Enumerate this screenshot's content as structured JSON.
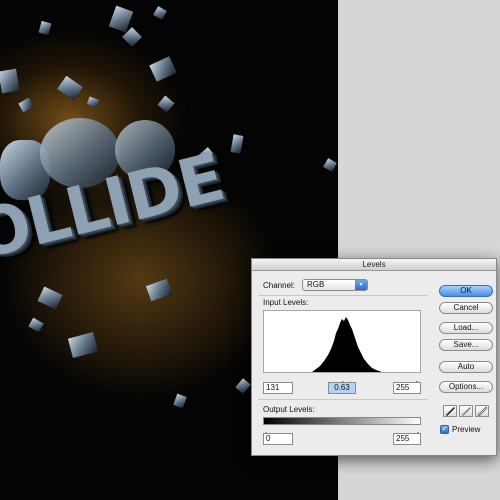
{
  "canvas": {
    "artwork_text": "OLLIDE"
  },
  "dialog": {
    "title": "Levels",
    "channel_label": "Channel:",
    "channel_value": "RGB",
    "input_levels_label": "Input Levels:",
    "input_black": "131",
    "input_gamma": "0.63",
    "input_white": "255",
    "output_levels_label": "Output Levels:",
    "output_black": "0",
    "output_white": "255",
    "buttons": {
      "ok": "OK",
      "cancel": "Cancel",
      "load": "Load...",
      "save": "Save...",
      "auto": "Auto",
      "options": "Options..."
    },
    "preview_label": "Preview",
    "preview_checked": true,
    "colors": {
      "accent": "#4b8fe6",
      "background": "#ececec"
    }
  }
}
